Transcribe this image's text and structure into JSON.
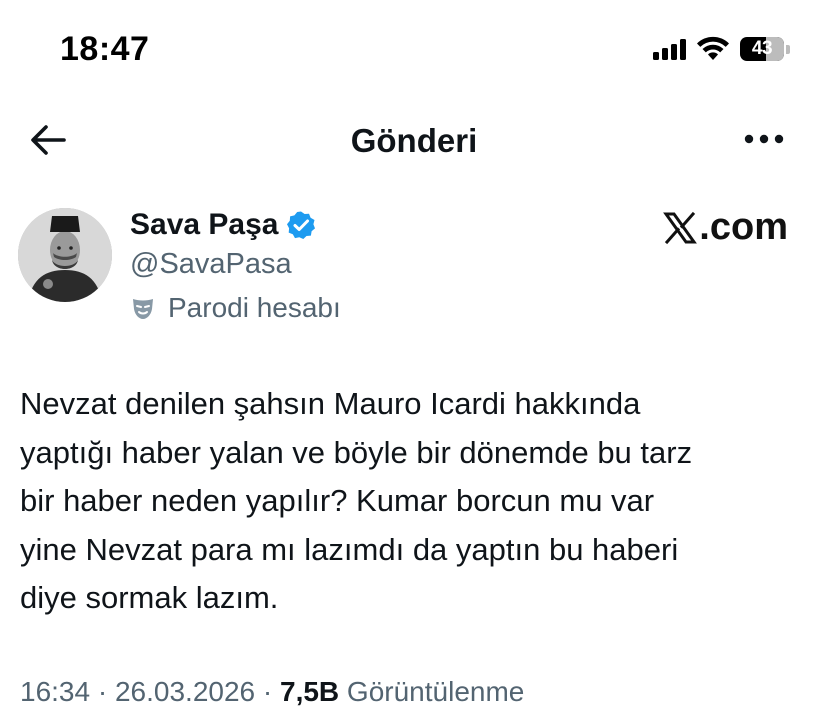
{
  "status_bar": {
    "time": "18:47",
    "battery_level": "43"
  },
  "nav": {
    "title": "Gönderi"
  },
  "author": {
    "display_name": "Sava Paşa",
    "handle": "@SavaPasa",
    "parody_label": "Parodi hesabı",
    "verified": true
  },
  "watermark": {
    "text": ".com"
  },
  "post": {
    "text": "Nevzat denilen şahsın Mauro Icardi hakkında\nyaptığı haber yalan ve böyle bir dönemde bu tarz\nbir haber neden yapılır? Kumar borcun mu var\nyine Nevzat para mı lazımdı da yaptın bu haberi\ndiye sormak lazım."
  },
  "meta": {
    "time": "16:34",
    "separator_1": " · ",
    "date": "26.03.2026",
    "separator_2": " · ",
    "views_count": "7,5B",
    "views_label": " Görüntülenme"
  },
  "colors": {
    "text": "#0f1419",
    "secondary": "#536471",
    "verified_blue": "#1d9bf0"
  }
}
